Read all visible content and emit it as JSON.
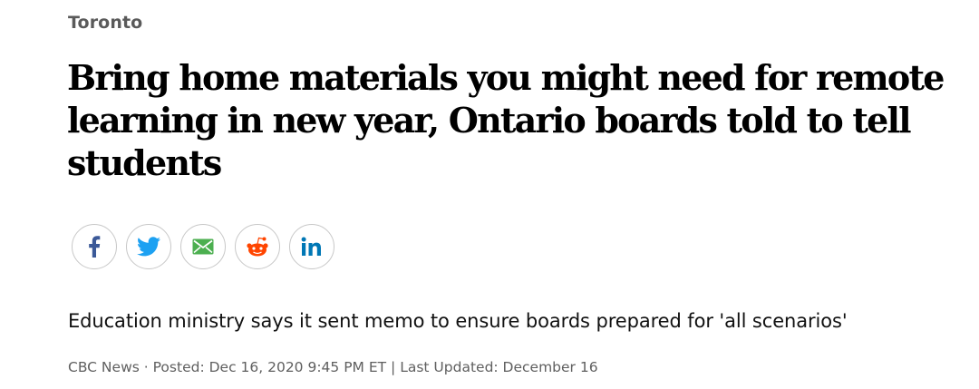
{
  "section": {
    "label": "Toronto"
  },
  "headline": "Bring home materials you might need for remote learning in new year, Ontario boards told to tell students",
  "share": {
    "buttons": [
      {
        "name": "facebook",
        "icon": "facebook-icon",
        "color": "#3b5998"
      },
      {
        "name": "twitter",
        "icon": "twitter-icon",
        "color": "#1da1f2"
      },
      {
        "name": "email",
        "icon": "email-icon",
        "color": "#4caf50"
      },
      {
        "name": "reddit",
        "icon": "reddit-icon",
        "color": "#ff4500"
      },
      {
        "name": "linkedin",
        "icon": "linkedin-icon",
        "color": "#0077b5"
      }
    ]
  },
  "deck": "Education ministry says it sent memo to ensure boards prepared for 'all scenarios'",
  "byline": {
    "source": "CBC News",
    "dot": "·",
    "posted": "Posted: Dec 16, 2020 9:45 PM ET",
    "divider": "|",
    "updated": "Last Updated: December 16"
  }
}
